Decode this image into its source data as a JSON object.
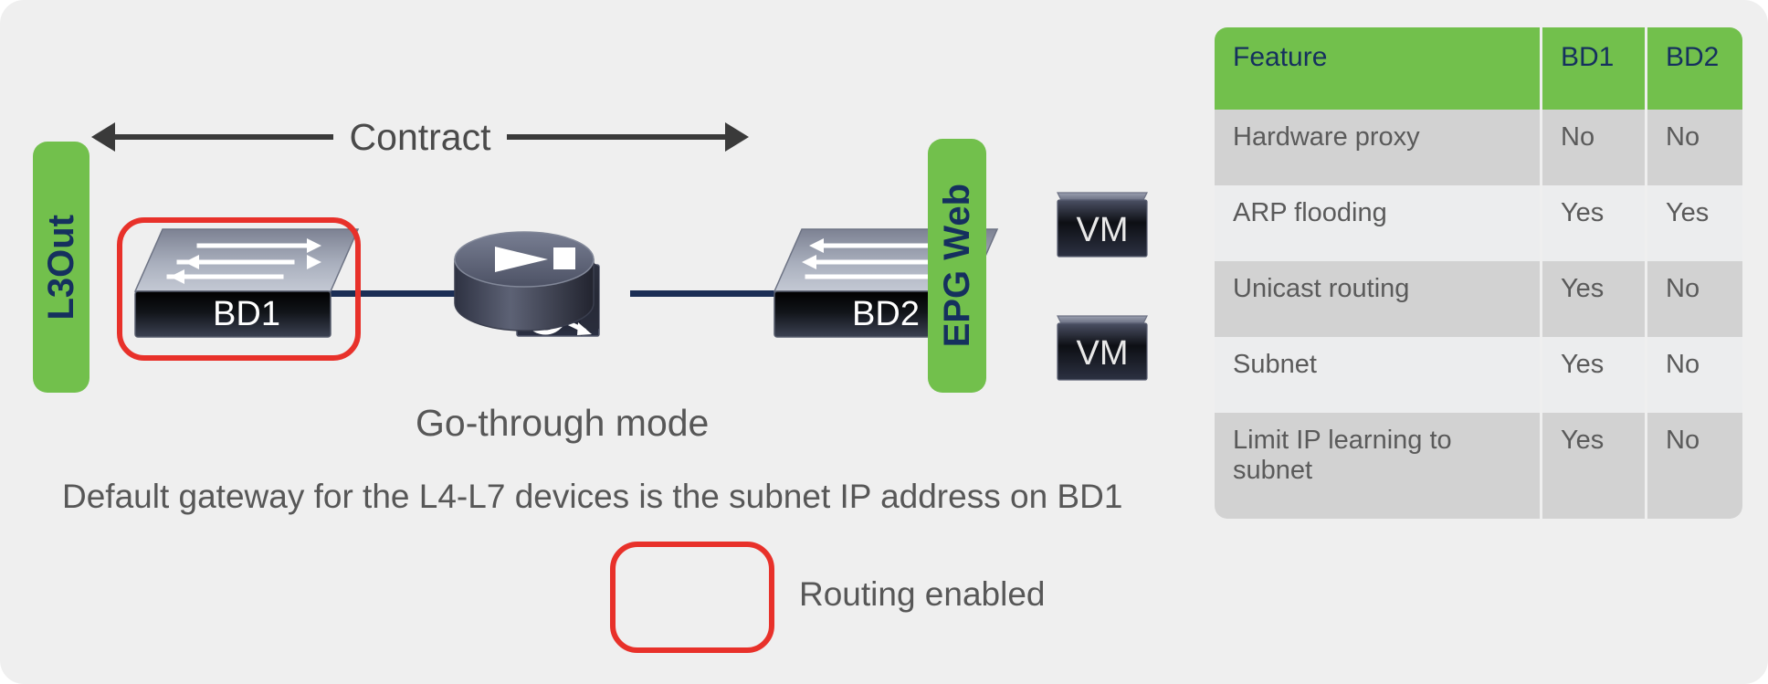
{
  "canvas": {
    "background": "#efefef",
    "accent_green": "#72c04c",
    "navy": "#15305e",
    "link_navy": "#1b2e55",
    "highlight_red": "#e8312a",
    "caption_gray": "#575757"
  },
  "diagram": {
    "l3out": {
      "label": "L3Out"
    },
    "epg_web": {
      "label": "EPG Web"
    },
    "contract": {
      "label": "Contract"
    },
    "bd1": {
      "label": "BD1"
    },
    "bd2": {
      "label": "BD2"
    },
    "service_node": {
      "mode_label": "Go-through mode"
    },
    "vms": [
      {
        "label": "VM"
      },
      {
        "label": "VM"
      }
    ],
    "gateway_note": "Default gateway for the L4-L7 devices is the subnet IP address on BD1",
    "legend": {
      "label": "Routing enabled"
    }
  },
  "table": {
    "headers": [
      "Feature",
      "BD1",
      "BD2"
    ],
    "rows": [
      {
        "feature": "Hardware proxy",
        "bd1": "No",
        "bd2": "No"
      },
      {
        "feature": "ARP flooding",
        "bd1": "Yes",
        "bd2": "Yes"
      },
      {
        "feature": "Unicast routing",
        "bd1": "Yes",
        "bd2": "No"
      },
      {
        "feature": "Subnet",
        "bd1": "Yes",
        "bd2": "No"
      },
      {
        "feature": "Limit IP learning to subnet",
        "bd1": "Yes",
        "bd2": "No"
      }
    ]
  }
}
